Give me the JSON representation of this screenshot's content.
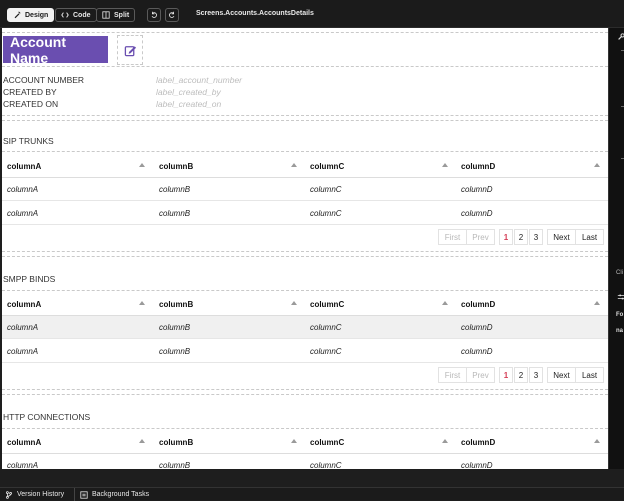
{
  "toolbar": {
    "design_label": "Design",
    "code_label": "Code",
    "split_label": "Split",
    "breadcrumb": "Screens.Accounts.AccountsDetails"
  },
  "icons": {
    "undo": "undo-icon",
    "redo": "redo-icon",
    "edit": "edit-icon",
    "branch": "branch-icon",
    "tasks": "tasks-icon"
  },
  "colors": {
    "accent": "#6a4eb0",
    "current_page": "#d43d55"
  },
  "account": {
    "title": "Account Name",
    "fields": [
      {
        "label": "ACCOUNT NUMBER",
        "value": "label_account_number"
      },
      {
        "label": "CREATED BY",
        "value": "label_created_by"
      },
      {
        "label": "CREATED ON",
        "value": "label_created_on"
      }
    ]
  },
  "sections": [
    {
      "title": "SIP TRUNKS",
      "columns": [
        "columnA",
        "columnB",
        "columnC",
        "columnD"
      ],
      "rows": [
        [
          "columnA",
          "columnB",
          "columnC",
          "columnD"
        ],
        [
          "columnA",
          "columnB",
          "columnC",
          "columnD"
        ]
      ],
      "pager": {
        "first": "First",
        "prev": "Prev",
        "pages": [
          "1",
          "2",
          "3"
        ],
        "current": "1",
        "next": "Next",
        "last": "Last"
      }
    },
    {
      "title": "SMPP BINDS",
      "columns": [
        "columnA",
        "columnB",
        "columnC",
        "columnD"
      ],
      "rows": [
        [
          "columnA",
          "columnB",
          "columnC",
          "columnD"
        ],
        [
          "columnA",
          "columnB",
          "columnC",
          "columnD"
        ]
      ],
      "pager": {
        "first": "First",
        "prev": "Prev",
        "pages": [
          "1",
          "2",
          "3"
        ],
        "current": "1",
        "next": "Next",
        "last": "Last"
      }
    },
    {
      "title": "HTTP CONNECTIONS",
      "columns": [
        "columnA",
        "columnB",
        "columnC",
        "columnD"
      ],
      "rows": [
        [
          "columnA",
          "columnB",
          "columnC",
          "columnD"
        ]
      ]
    }
  ],
  "right_panel": {
    "cli_label": "Cli",
    "fo_label": "Fo",
    "na_label": "na"
  },
  "statusbar": {
    "version_history": "Version History",
    "background_tasks": "Background Tasks"
  }
}
